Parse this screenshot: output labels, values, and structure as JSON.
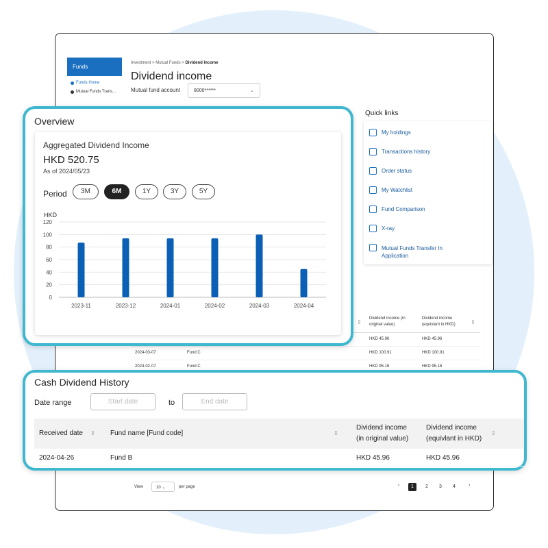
{
  "sidebar": {
    "header": "Funds",
    "items": [
      {
        "label": "Funds Home"
      },
      {
        "label": "Mutual Funds Trans..."
      }
    ]
  },
  "breadcrumb": {
    "part1": "Investment",
    "sep": ">",
    "part2": "Mutual Funds",
    "current": "Dividend Income"
  },
  "page": {
    "title": "Dividend income",
    "account_label": "Mutual fund account",
    "account_value": "8000******"
  },
  "quick_links": {
    "title": "Quick links",
    "items": [
      {
        "label": "My holdings",
        "icon": "holdings-chart-icon"
      },
      {
        "label": "Transactions history",
        "icon": "transactions-icon"
      },
      {
        "label": "Order status",
        "icon": "order-status-icon"
      },
      {
        "label": "My Watchlist",
        "icon": "watchlist-icon"
      },
      {
        "label": "Fund Comparison",
        "icon": "fund-comparison-icon"
      },
      {
        "label": "X-ray",
        "icon": "xray-icon"
      },
      {
        "label": "Mutual Funds Transfer In Application",
        "icon": "transfer-arrows-icon"
      }
    ]
  },
  "bg_table": {
    "headers": [
      "Dividend income (in original value)",
      "Dividend income (equivlant in HKD)"
    ],
    "rows": [
      {
        "date": "",
        "fund": "",
        "orig": "HKD 45.96",
        "hkd": "HKD 45.96"
      },
      {
        "date": "2024-03-07",
        "fund": "Fund C",
        "orig": "HKD 100.91",
        "hkd": "HKD 100.91"
      },
      {
        "date": "2024-02-07",
        "fund": "Fund C",
        "orig": "HKD 95.16",
        "hkd": "HKD 95.16"
      }
    ]
  },
  "pager": {
    "view": "View",
    "per_page_value": "10",
    "per_page_label": "per page",
    "prev": "‹",
    "next": "›",
    "pages": [
      "1",
      "2",
      "3",
      "4"
    ]
  },
  "overview": {
    "title": "Overview",
    "agg_title": "Aggregated Dividend Income",
    "agg_value": "HKD 520.75",
    "as_of": "As of 2024/05/23",
    "period_label": "Period",
    "periods": [
      "3M",
      "6M",
      "1Y",
      "3Y",
      "5Y"
    ],
    "selected_period": "6M"
  },
  "chart_data": {
    "type": "bar",
    "categories": [
      "2023-11",
      "2023-12",
      "2024-01",
      "2024-02",
      "2024-03",
      "2024-04"
    ],
    "values": [
      87,
      94,
      94,
      94,
      100,
      45
    ],
    "ylabel": "HKD",
    "ylim": [
      0,
      120
    ],
    "yticks": [
      0,
      20,
      40,
      60,
      80,
      100,
      120
    ],
    "grid": true,
    "bar_color": "#0b5fb4"
  },
  "cash_dividend": {
    "title": "Cash Dividend History",
    "date_range_label": "Date range",
    "start_placeholder": "Start date",
    "to_label": "to",
    "end_placeholder": "End date",
    "headers": {
      "received_date": "Received date",
      "fund_name": "Fund name [Fund code]",
      "div_orig_1": "Dividend income",
      "div_orig_2": "(in original value)",
      "div_hkd_1": "Dividend income",
      "div_hkd_2": "(equivlant in HKD)"
    },
    "rows": [
      {
        "date": "2024-04-26",
        "fund": "Fund B",
        "orig": "HKD 45.96",
        "hkd": "HKD 45.96"
      }
    ]
  },
  "colors": {
    "accent": "#1a6fc0",
    "highlight_border": "#3fb8cf",
    "background_circle": "#e3f0fc"
  }
}
